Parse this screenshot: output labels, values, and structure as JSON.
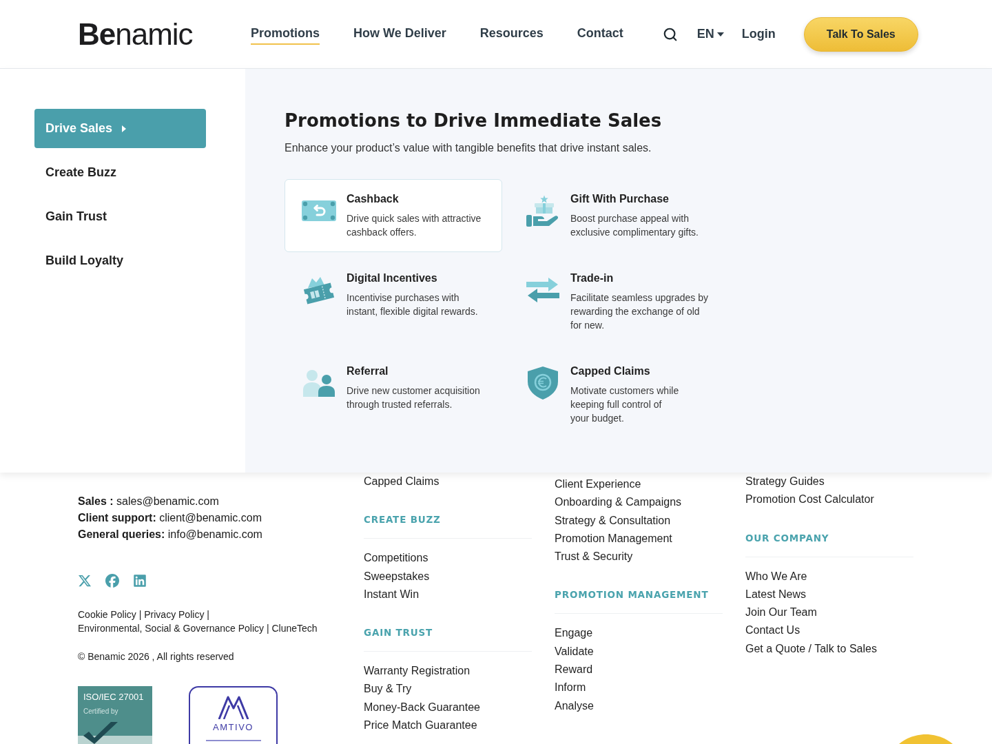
{
  "header": {
    "logo": "**Be**namic",
    "nav": [
      {
        "label": "Promotions",
        "selected": true
      },
      {
        "label": "How We Deliver",
        "selected": false
      },
      {
        "label": "Resources",
        "selected": false
      },
      {
        "label": "Contact",
        "selected": false
      }
    ],
    "language": "EN",
    "login": "Login",
    "cta": "Talk To Sales"
  },
  "mega_menu": {
    "sidebar": [
      {
        "label": "Drive Sales",
        "selected": true
      },
      {
        "label": "Create Buzz",
        "selected": false
      },
      {
        "label": "Gain Trust",
        "selected": false
      },
      {
        "label": "Build Loyalty",
        "selected": false
      }
    ],
    "title": "Promotions to Drive Immediate Sales",
    "subtitle": "Enhance your product’s value with tangible benefits that drive instant sales.",
    "promotions": [
      {
        "kind": "cashback",
        "title": "Cashback",
        "description": "Drive quick sales with attractive\ncashback offers.",
        "highlighted": true
      },
      {
        "kind": "gift",
        "title": "Gift With Purchase",
        "description": "Boost purchase appeal with\nexclusive complimentary gifts.",
        "highlighted": false
      },
      {
        "kind": "digital",
        "title": "Digital Incentives",
        "description": "Incentivise purchases with\ninstant, flexible digital rewards.",
        "highlighted": false
      },
      {
        "kind": "trade-in",
        "title": "Trade-in",
        "description": "Facilitate seamless upgrades by\nrewarding the exchange of old\nfor new.",
        "highlighted": false
      },
      {
        "kind": "referral",
        "title": "Referral",
        "description": "Drive new customer acquisition\nthrough trusted referrals.",
        "highlighted": false
      },
      {
        "kind": "capped",
        "title": "Capped Claims",
        "description": "Motivate customers while\nkeeping full control of\nyour budget.",
        "highlighted": false
      }
    ]
  },
  "footer": {
    "contacts": [
      "**Sales :** sales@benamic.com",
      "**Client support:** client@benamic.com",
      "**General queries:** info@benamic.com"
    ],
    "legal_links": [
      {
        "label": "Cookie Policy",
        "separator": "|"
      },
      {
        "label": "Privacy Policy",
        "separator": "|"
      },
      {
        "label": "Environmental, Social & Governance Policy",
        "separator": "|"
      },
      {
        "label": "CluneTech"
      }
    ],
    "copyright": "© Benamic 2026 , All rights reserved",
    "iso_badge": {
      "title": "ISO/IEC 27001",
      "subtitle": "Certified by"
    },
    "amtivo_badge": {
      "name": "AMTIVO"
    },
    "link_columns": [
      {
        "groups": [
          {
            "links": [
              "Capped Claims"
            ]
          },
          {
            "heading": "CREATE BUZZ",
            "links": [
              "Competitions",
              "Sweepstakes",
              "Instant Win"
            ]
          },
          {
            "heading": "GAIN TRUST",
            "links": [
              "Warranty Registration",
              "Buy & Try",
              "Money-Back Guarantee",
              "Price Match Guarantee"
            ]
          }
        ]
      },
      {
        "groups": [
          {
            "links": [
              "Client Experience",
              "Onboarding & Campaigns",
              "Strategy & Consultation",
              "Promotion Management",
              "Trust & Security"
            ]
          },
          {
            "heading": "PROMOTION MANAGEMENT",
            "links": [
              "Engage",
              "Validate",
              "Reward",
              "Inform",
              "Analyse"
            ]
          }
        ]
      },
      {
        "groups": [
          {
            "links": [
              "Strategy Guides",
              "Promotion Cost Calculator"
            ]
          },
          {
            "heading": "OUR COMPANY",
            "links": [
              "Who We Are",
              "Latest News",
              "Join Our Team",
              "Contact Us",
              "Get a Quote / Talk to Sales"
            ]
          }
        ]
      }
    ]
  }
}
